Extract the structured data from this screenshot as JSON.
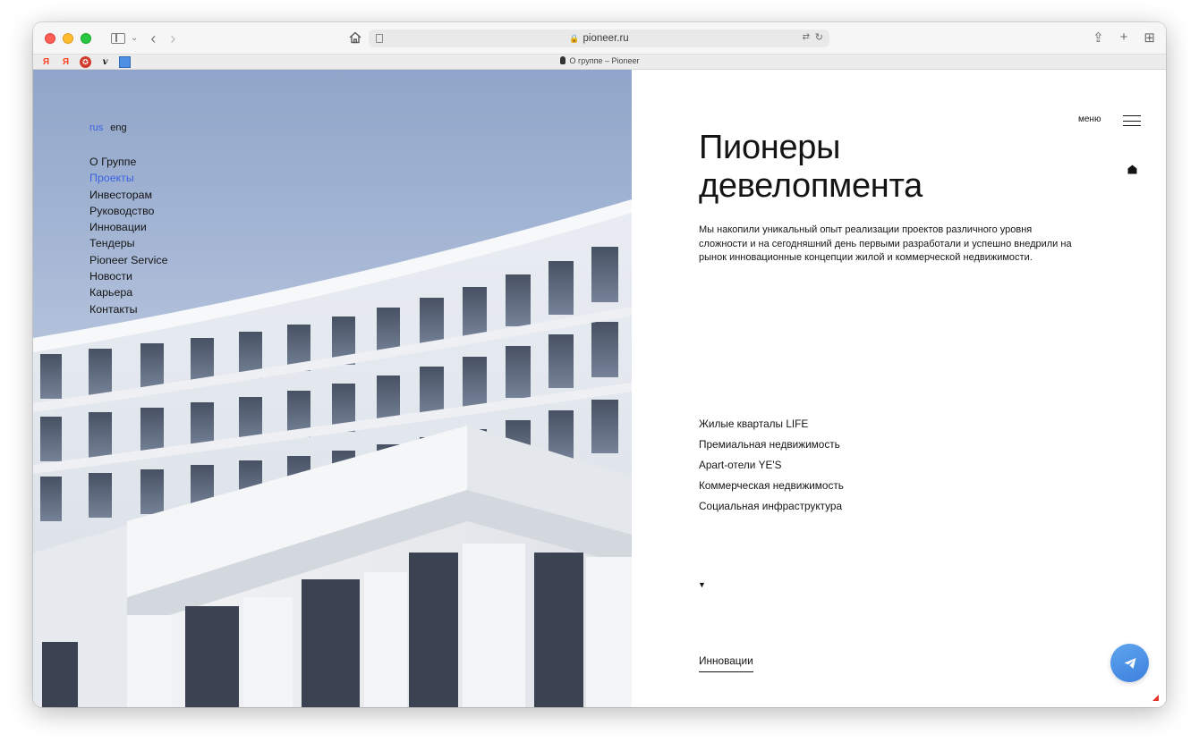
{
  "browser": {
    "url": "pioneer.ru",
    "tab_title": "О группе – Pioneer",
    "favorites": [
      "Я",
      "Я",
      "✪",
      "v",
      ""
    ]
  },
  "lang": {
    "rus": "rus",
    "eng": "eng"
  },
  "nav": {
    "items": [
      {
        "label": "О Группе",
        "active": false
      },
      {
        "label": "Проекты",
        "active": true
      },
      {
        "label": "Инвесторам",
        "active": false
      },
      {
        "label": "Руководство",
        "active": false
      },
      {
        "label": "Инновации",
        "active": false
      },
      {
        "label": "Тендеры",
        "active": false
      },
      {
        "label": "Pioneer Service",
        "active": false
      },
      {
        "label": "Новости",
        "active": false
      },
      {
        "label": "Карьера",
        "active": false
      },
      {
        "label": "Контакты",
        "active": false
      }
    ]
  },
  "header": {
    "menu_label": "меню"
  },
  "hero": {
    "title_line1": "Пионеры",
    "title_line2": "девелопмента",
    "text": "Мы накопили уникальный опыт реализации проектов различного уровня сложности и на сегодняшний день первыми разработали и успешно внедрили на рынок инновационные концепции жилой и коммерческой недвижимости."
  },
  "categories": [
    "Жилые кварталы LIFE",
    "Премиальная недвижимость",
    "Apart-отели YE'S",
    "Коммерческая недвижимость",
    "Социальная инфраструктура"
  ],
  "section_link": "Инновации",
  "colors": {
    "accent": "#3c62e0",
    "text": "#141414",
    "telegram": "#4a8fe6"
  },
  "icons": {
    "home": "home-icon",
    "menu": "hamburger-icon",
    "telegram": "paper-plane-icon",
    "scroll": "triangle-down-icon"
  }
}
